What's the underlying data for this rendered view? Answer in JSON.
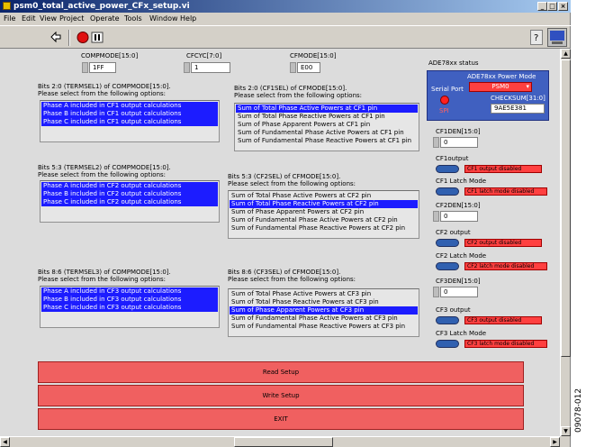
{
  "window": {
    "title": "psm0_total_active_power_CFx_setup.vi",
    "controls": {
      "minimize": "_",
      "maximize": "□",
      "close": "×"
    }
  },
  "menu": [
    "File",
    "Edit",
    "View",
    "Project",
    "Operate",
    "Tools",
    "Window",
    "Help"
  ],
  "registers": {
    "compmode": {
      "label": "COMPMODE[15:0]",
      "value": "1FF"
    },
    "cfcyc": {
      "label": "CFCYC[7:0]",
      "value": "1"
    },
    "cfmode": {
      "label": "CFMODE[15:0]",
      "value": "E00"
    }
  },
  "cf1": {
    "termsel_title": "Bits 2:0 (TERMSEL1) of COMPMODE[15:0].",
    "termsel_prompt": "Please select from the following options:",
    "termsel_options": [
      {
        "text": "Phase A included in CF1 output calculations",
        "selected": true
      },
      {
        "text": "Phase B included in CF1 output calculations",
        "selected": true
      },
      {
        "text": "Phase C included in CF1 output calculations",
        "selected": true
      }
    ],
    "sel_title": "Bits 2:0 (CF1SEL) of CFMODE[15:0].",
    "sel_prompt": "Please select from the following options:",
    "sel_options": [
      {
        "text": "Sum of Total Phase Active Powers at CF1 pin",
        "selected": true
      },
      {
        "text": "Sum of Total Phase Reactive Powers at CF1 pin",
        "selected": false
      },
      {
        "text": "Sum of Phase Apparent Powers at CF1 pin",
        "selected": false
      },
      {
        "text": "Sum of Fundamental Phase Active Powers at CF1 pin",
        "selected": false
      },
      {
        "text": "Sum of Fundamental Phase Reactive Powers at CF1 pin",
        "selected": false
      }
    ]
  },
  "cf2": {
    "termsel_title": "Bits 5:3 (TERMSEL2) of COMPMODE[15:0].",
    "termsel_prompt": "Please select from the following options:",
    "termsel_options": [
      {
        "text": "Phase A included in CF2 output calculations",
        "selected": true
      },
      {
        "text": "Phase B included in CF2 output calculations",
        "selected": true
      },
      {
        "text": "Phase C included in CF2 output calculations",
        "selected": true
      }
    ],
    "sel_title": "Bits 5:3 (CF2SEL) of CFMODE[15:0].",
    "sel_prompt": "Please select from the following options:",
    "sel_options": [
      {
        "text": "Sum of Total Phase Active Powers at CF2 pin",
        "selected": false
      },
      {
        "text": "Sum of Total Phase Reactive Powers at CF2 pin",
        "selected": true
      },
      {
        "text": "Sum of Phase Apparent Powers at CF2 pin",
        "selected": false
      },
      {
        "text": "Sum of Fundamental Phase Active Powers at CF2 pin",
        "selected": false
      },
      {
        "text": "Sum of Fundamental Phase Reactive Powers at CF2 pin",
        "selected": false
      }
    ]
  },
  "cf3": {
    "termsel_title": "Bits 8:6 (TERMSEL3) of COMPMODE[15:0].",
    "termsel_prompt": "Please select from the following options:",
    "termsel_options": [
      {
        "text": "Phase A included in CF3 output calculations",
        "selected": true
      },
      {
        "text": "Phase B included in CF3 output calculations",
        "selected": true
      },
      {
        "text": "Phase C included in CF3 output calculations",
        "selected": true
      }
    ],
    "sel_title": "Bits 8:6 (CF3SEL) of CFMODE[15:0].",
    "sel_prompt": "Please select from the following options:",
    "sel_options": [
      {
        "text": "Sum of Total Phase Active Powers at CF3 pin",
        "selected": false
      },
      {
        "text": "Sum of Total Phase Reactive Powers at CF3 pin",
        "selected": false
      },
      {
        "text": "Sum of Phase Apparent Powers at CF3 pin",
        "selected": true
      },
      {
        "text": "Sum of Fundamental Phase Active Powers at CF3 pin",
        "selected": false
      },
      {
        "text": "Sum of Fundamental Phase Reactive Powers at CF3 pin",
        "selected": false
      }
    ]
  },
  "status": {
    "title": "ADE78xx status",
    "power_mode_label": "ADE78xx Power Mode",
    "power_mode_value": "PSM0",
    "serial_port_label": "Serial Port",
    "spi_label": "SPI",
    "checksum_label": "CHECKSUM[31:0]",
    "checksum_value": "9AE5E381"
  },
  "side": {
    "cf1den_label": "CF1DEN[15:0]",
    "cf1den_value": "0",
    "cf1output_label": "CF1output",
    "cf1output_status": "CF1 output disabled",
    "cf1latch_label": "CF1 Latch Mode",
    "cf1latch_status": "CF1 latch mode disabled",
    "cf2den_label": "CF2DEN[15:0]",
    "cf2den_value": "0",
    "cf2output_label": "CF2 output",
    "cf2output_status": "CF2 output disabled",
    "cf2latch_label": "CF2 Latch Mode",
    "cf2latch_status": "CF2 latch mode disabled",
    "cf3den_label": "CF3DEN[15:0]",
    "cf3den_value": "0",
    "cf3output_label": "CF3 output",
    "cf3output_status": "CF3 output disabled",
    "cf3latch_label": "CF3 Latch Mode",
    "cf3latch_status": "CF3 latch mode disabled"
  },
  "buttons": {
    "read": "Read Setup",
    "write": "Write Setup",
    "exit": "EXIT"
  },
  "figure_id": "09078-012",
  "colors": {
    "selection": "#1c1cff",
    "button_red": "#f06060",
    "indicator_red": "#ff4040",
    "status_panel": "#4060c0",
    "title_bar": "#0a246a"
  }
}
